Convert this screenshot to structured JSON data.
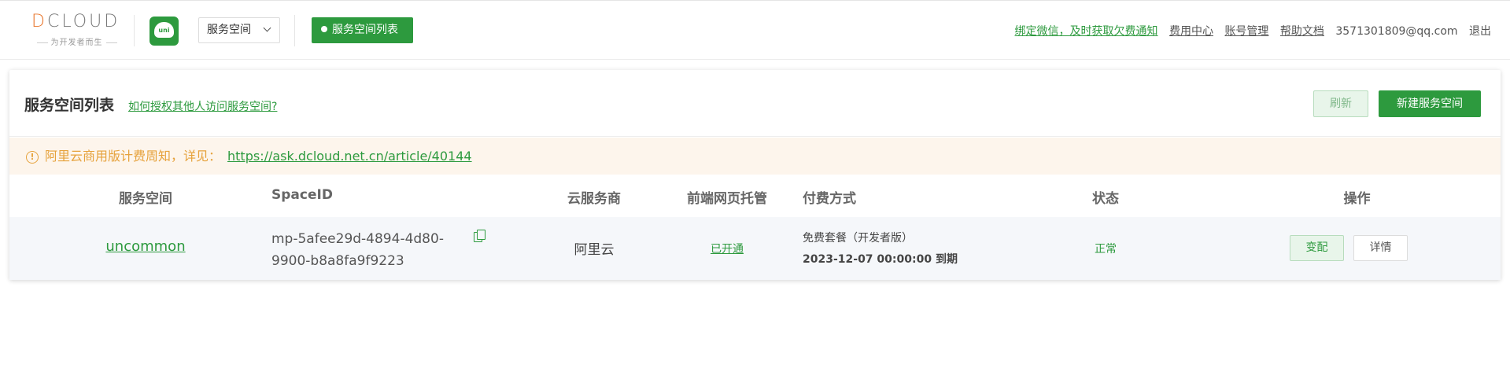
{
  "logo": {
    "brand_prefix": "D",
    "brand_rest": "CLOUD",
    "tagline": "为开发者而生"
  },
  "uni_badge": {
    "text": "uni"
  },
  "header": {
    "space_select": "服务空间",
    "list_pill": "服务空间列表",
    "links": {
      "wechat": "绑定微信，及时获取欠费通知",
      "billing": "费用中心",
      "account": "账号管理",
      "help": "帮助文档",
      "email": "3571301809@qq.com",
      "logout": "退出"
    }
  },
  "card": {
    "title": "服务空间列表",
    "help_link": "如何授权其他人访问服务空间?",
    "refresh_button": "刷新",
    "new_button": "新建服务空间"
  },
  "notice": {
    "icon": "info-icon",
    "text": "阿里云商用版计费周知，详见：",
    "link": "https://ask.dcloud.net.cn/article/40144"
  },
  "table": {
    "columns": [
      "服务空间",
      "SpaceID",
      "云服务商",
      "前端网页托管",
      "付费方式",
      "状态",
      "操作"
    ],
    "rows": [
      {
        "space": "uncommon",
        "space_id_line1": "mp-5afee29d-4894-4d80-",
        "space_id_line2": "9900-b8a8fa9f9223",
        "provider": "阿里云",
        "hosting": "已开通",
        "pay_plan": "免费套餐（开发者版）",
        "pay_expiry": "2023-12-07 00:00:00 到期",
        "status": "正常",
        "op_change": "变配",
        "op_detail": "详情"
      }
    ]
  },
  "colors": {
    "brand_green": "#2d9a3e",
    "notice_bg": "#fdf5ec",
    "notice_text": "#e6a23c",
    "logo_accent": "#e8742a"
  }
}
